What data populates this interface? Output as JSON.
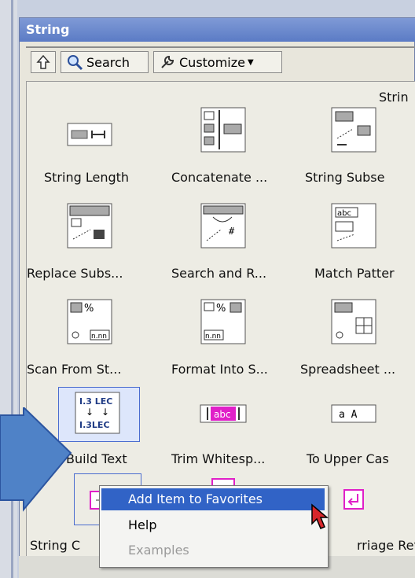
{
  "palette": {
    "title": "String"
  },
  "toolbar": {
    "search_label": "Search",
    "customize_label": "Customize",
    "category_heading": "Strin"
  },
  "items": [
    {
      "label": "String Length"
    },
    {
      "label": "Concatenate ..."
    },
    {
      "label": "String Subse"
    },
    {
      "label": "Replace Subs..."
    },
    {
      "label": "Search and R..."
    },
    {
      "label": "Match Patter"
    },
    {
      "label": "Scan From St..."
    },
    {
      "label": "Format Into S..."
    },
    {
      "label": "Spreadsheet ..."
    },
    {
      "label": "Build Text"
    },
    {
      "label": "Trim Whitesp..."
    },
    {
      "label": "To Upper Cas"
    },
    {
      "label": "String C"
    },
    {
      "label": "rriage Ret."
    }
  ],
  "icon_text": {
    "build_top": "I.3  LEC",
    "build_bottom": "I.3LEC",
    "trim": "abc",
    "upper": "a A",
    "scan_pct": "%",
    "format_pct": "%",
    "nnn": "n.nn",
    "abc": "abc"
  },
  "context_menu": {
    "items": [
      "Add Item to Favorites",
      "Help",
      "Examples"
    ]
  },
  "colors": {
    "title_bar": "#5b7bc5",
    "highlight": "#3163c6",
    "callout": "#4f82c7"
  }
}
